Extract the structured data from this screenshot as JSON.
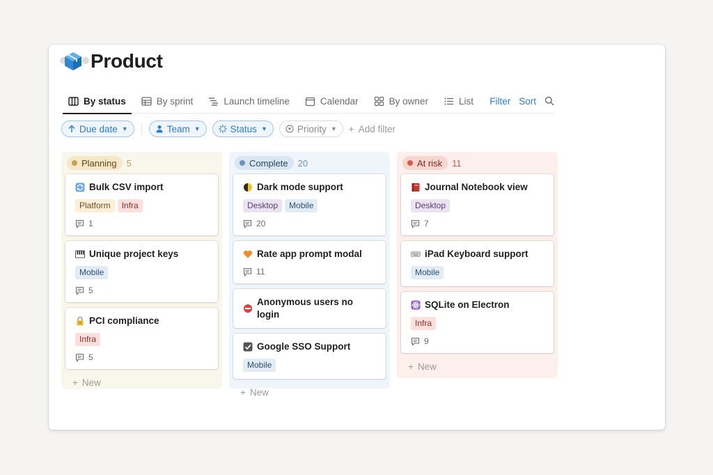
{
  "page": {
    "title": "Product",
    "icon": "cube-icon"
  },
  "views": {
    "tabs": [
      {
        "label": "By status",
        "icon": "board-icon",
        "active": true
      },
      {
        "label": "By sprint",
        "icon": "table-icon"
      },
      {
        "label": "Launch timeline",
        "icon": "timeline-icon"
      },
      {
        "label": "Calendar",
        "icon": "calendar-icon"
      },
      {
        "label": "By owner",
        "icon": "gallery-icon"
      },
      {
        "label": "List",
        "icon": "list-icon"
      }
    ],
    "filter_label": "Filter",
    "sort_label": "Sort"
  },
  "filters": {
    "due_date": "Due date",
    "team": "Team",
    "status": "Status",
    "priority": "Priority",
    "add_filter": "Add filter"
  },
  "colors": {
    "accent": "#2e7dd1"
  },
  "board": {
    "new_label": "New",
    "columns": [
      {
        "name": "Planning",
        "count": "5",
        "pill_bg": "#f4e8c8",
        "dot": "#c9a04b",
        "text": "#5f4613",
        "cards": [
          {
            "title": "Bulk CSV import",
            "emoji": "refresh-icon",
            "tags": [
              "Platform",
              "Infra"
            ],
            "comments": "1"
          },
          {
            "title": "Unique project keys",
            "emoji": "piano-icon",
            "tags": [
              "Mobile"
            ],
            "comments": "5"
          },
          {
            "title": "PCI compliance",
            "emoji": "lock-icon",
            "tags": [
              "Infra"
            ],
            "comments": "5"
          }
        ]
      },
      {
        "name": "Complete",
        "count": "20",
        "pill_bg": "#dae6f2",
        "dot": "#6b92b9",
        "text": "#2b4662",
        "cards": [
          {
            "title": "Dark mode support",
            "emoji": "moon-icon",
            "tags": [
              "Desktop",
              "Mobile"
            ],
            "comments": "20"
          },
          {
            "title": "Rate app prompt modal",
            "emoji": "heart-icon",
            "tags": [],
            "comments": "11"
          },
          {
            "title": "Anonymous users no login",
            "emoji": "no-entry-icon",
            "tags": [],
            "comments": ""
          },
          {
            "title": "Google SSO Support",
            "emoji": "checkbox-icon",
            "tags": [
              "Mobile"
            ],
            "comments": ""
          }
        ]
      },
      {
        "name": "At risk",
        "count": "11",
        "pill_bg": "#f7d6d0",
        "dot": "#d9594a",
        "text": "#7f2a20",
        "cards": [
          {
            "title": "Journal Notebook view",
            "emoji": "book-icon",
            "tags": [
              "Desktop"
            ],
            "comments": "7"
          },
          {
            "title": "iPad Keyboard support",
            "emoji": "keyboard-icon",
            "tags": [
              "Mobile"
            ],
            "comments": ""
          },
          {
            "title": "SQLite on Electron",
            "emoji": "atom-icon",
            "tags": [
              "Infra"
            ],
            "comments": "9"
          }
        ]
      }
    ]
  }
}
